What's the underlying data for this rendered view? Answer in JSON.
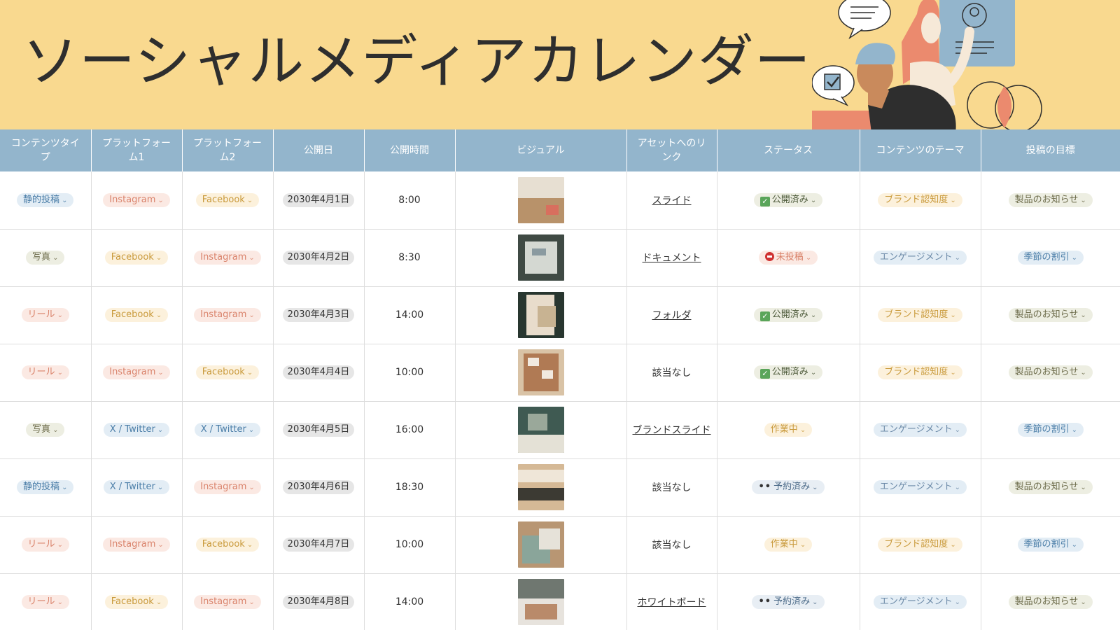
{
  "page": {
    "title": "ソーシャルメディアカレンダー"
  },
  "columns": [
    "コンテンツタイプ",
    "プラットフォーム1",
    "プラットフォーム2",
    "公開日",
    "公開時間",
    "ビジュアル",
    "アセットへのリンク",
    "ステータス",
    "コンテンツのテーマ",
    "投稿の目標"
  ],
  "tag_colors": {
    "静的投稿": {
      "bg": "#e3edf5",
      "fg": "#4b7ea8"
    },
    "写真": {
      "bg": "#edeee2",
      "fg": "#6c6b4a"
    },
    "リール": {
      "bg": "#fbe9e3",
      "fg": "#d9826a"
    },
    "Instagram": {
      "bg": "#fbe9e3",
      "fg": "#d9826a"
    },
    "Facebook": {
      "bg": "#fcf1dc",
      "fg": "#c99a3c"
    },
    "X / Twitter": {
      "bg": "#e3edf5",
      "fg": "#4b7ea8"
    },
    "公開済み": {
      "bg": "#edeee2",
      "fg": "#4d5a3a"
    },
    "未投稿": {
      "bg": "#fbe9e3",
      "fg": "#d9826a"
    },
    "作業中": {
      "bg": "#fcf1dc",
      "fg": "#c99a3c"
    },
    "予約済み": {
      "bg": "#e8eef4",
      "fg": "#4b6a88"
    },
    "ブランド認知度": {
      "bg": "#fcf1dc",
      "fg": "#c99a3c"
    },
    "エンゲージメント": {
      "bg": "#e3edf5",
      "fg": "#6c8aa8"
    },
    "製品のお知らせ": {
      "bg": "#edeee2",
      "fg": "#6c6b4a"
    },
    "季節の割引": {
      "bg": "#e3edf5",
      "fg": "#4b7ea8"
    }
  },
  "status_icons": {
    "公開済み": "check-box-icon",
    "未投稿": "no-entry-icon",
    "作業中": "",
    "予約済み": "dots-icon"
  },
  "rows": [
    {
      "type": "静的投稿",
      "platform1": "Instagram",
      "platform2": "Facebook",
      "date": "2030年4月1日",
      "time": "8:00",
      "visual": {
        "name": "wood-desk-photo",
        "c1": "#e7dfd2",
        "c2": "#b8926a",
        "c3": "#d86f5e"
      },
      "link": "スライド",
      "link_is_link": true,
      "status": "公開済み",
      "theme": "ブランド認知度",
      "goal": "製品のお知らせ"
    },
    {
      "type": "写真",
      "platform1": "Facebook",
      "platform2": "Instagram",
      "date": "2030年4月2日",
      "time": "8:30",
      "visual": {
        "name": "team-table-photo",
        "c1": "#3f4a44",
        "c2": "#8a9aa0",
        "c3": "#d4d8d2"
      },
      "link": "ドキュメント",
      "link_is_link": true,
      "status": "未投稿",
      "theme": "エンゲージメント",
      "goal": "季節の割引"
    },
    {
      "type": "リール",
      "platform1": "Facebook",
      "platform2": "Instagram",
      "date": "2030年4月3日",
      "time": "14:00",
      "visual": {
        "name": "swatches-photo",
        "c1": "#28362f",
        "c2": "#e8dccb",
        "c3": "#c8b392"
      },
      "link": "フォルダ",
      "link_is_link": true,
      "status": "公開済み",
      "theme": "ブランド認知度",
      "goal": "製品のお知らせ"
    },
    {
      "type": "リール",
      "platform1": "Instagram",
      "platform2": "Facebook",
      "date": "2030年4月4日",
      "time": "10:00",
      "visual": {
        "name": "moodboard-photo",
        "c1": "#d9c3a6",
        "c2": "#b07a54",
        "c3": "#f1e9df"
      },
      "link": "該当なし",
      "link_is_link": false,
      "status": "公開済み",
      "theme": "ブランド認知度",
      "goal": "製品のお知らせ"
    },
    {
      "type": "写真",
      "platform1": "X / Twitter",
      "platform2": "X / Twitter",
      "date": "2030年4月5日",
      "time": "16:00",
      "visual": {
        "name": "living-room-photo",
        "c1": "#3f5a52",
        "c2": "#e4e1d6",
        "c3": "#9aa89a"
      },
      "link": "ブランドスライド",
      "link_is_link": true,
      "status": "作業中",
      "theme": "エンゲージメント",
      "goal": "季節の割引"
    },
    {
      "type": "静的投稿",
      "platform1": "X / Twitter",
      "platform2": "Instagram",
      "date": "2030年4月6日",
      "time": "18:30",
      "visual": {
        "name": "fabric-rolls-photo",
        "c1": "#d5b996",
        "c2": "#3c3a33",
        "c3": "#efe6d8"
      },
      "link": "該当なし",
      "link_is_link": false,
      "status": "予約済み",
      "theme": "エンゲージメント",
      "goal": "製品のお知らせ"
    },
    {
      "type": "リール",
      "platform1": "Instagram",
      "platform2": "Facebook",
      "date": "2030年4月7日",
      "time": "10:00",
      "visual": {
        "name": "material-samples-photo",
        "c1": "#b89673",
        "c2": "#8aa59a",
        "c3": "#e6e2d9"
      },
      "link": "該当なし",
      "link_is_link": false,
      "status": "作業中",
      "theme": "ブランド認知度",
      "goal": "季節の割引"
    },
    {
      "type": "リール",
      "platform1": "Facebook",
      "platform2": "Instagram",
      "date": "2030年4月8日",
      "time": "14:00",
      "visual": {
        "name": "studio-workspace-photo",
        "c1": "#e7e3dd",
        "c2": "#b98a6a",
        "c3": "#6f7770"
      },
      "link": "ホワイトボード",
      "link_is_link": true,
      "status": "予約済み",
      "theme": "エンゲージメント",
      "goal": "製品のお知らせ"
    }
  ]
}
